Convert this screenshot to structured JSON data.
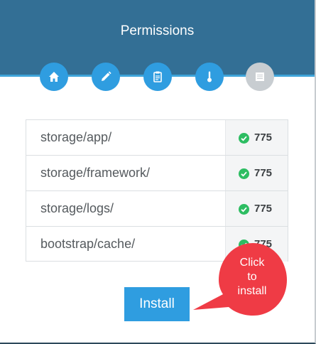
{
  "header": {
    "title": "Permissions"
  },
  "steps": [
    {
      "icon": "home-icon",
      "state": "complete"
    },
    {
      "icon": "pencil-icon",
      "state": "complete"
    },
    {
      "icon": "clipboard-icon",
      "state": "complete"
    },
    {
      "icon": "thermometer-icon",
      "state": "complete"
    },
    {
      "icon": "document-icon",
      "state": "inactive"
    }
  ],
  "permissions": [
    {
      "path": "storage/app/",
      "value": "775",
      "status": "ok"
    },
    {
      "path": "storage/framework/",
      "value": "775",
      "status": "ok"
    },
    {
      "path": "storage/logs/",
      "value": "775",
      "status": "ok"
    },
    {
      "path": "bootstrap/cache/",
      "value": "775",
      "status": "ok"
    }
  ],
  "actions": {
    "install_label": "Install"
  },
  "annotation": {
    "text_line1": "Click",
    "text_line2": "to",
    "text_line3": "install"
  },
  "colors": {
    "header": "#336f95",
    "accent": "#2f9de0",
    "success": "#2dbd62",
    "callout": "#ef3b45",
    "inactive_step": "#c8cdd1"
  }
}
